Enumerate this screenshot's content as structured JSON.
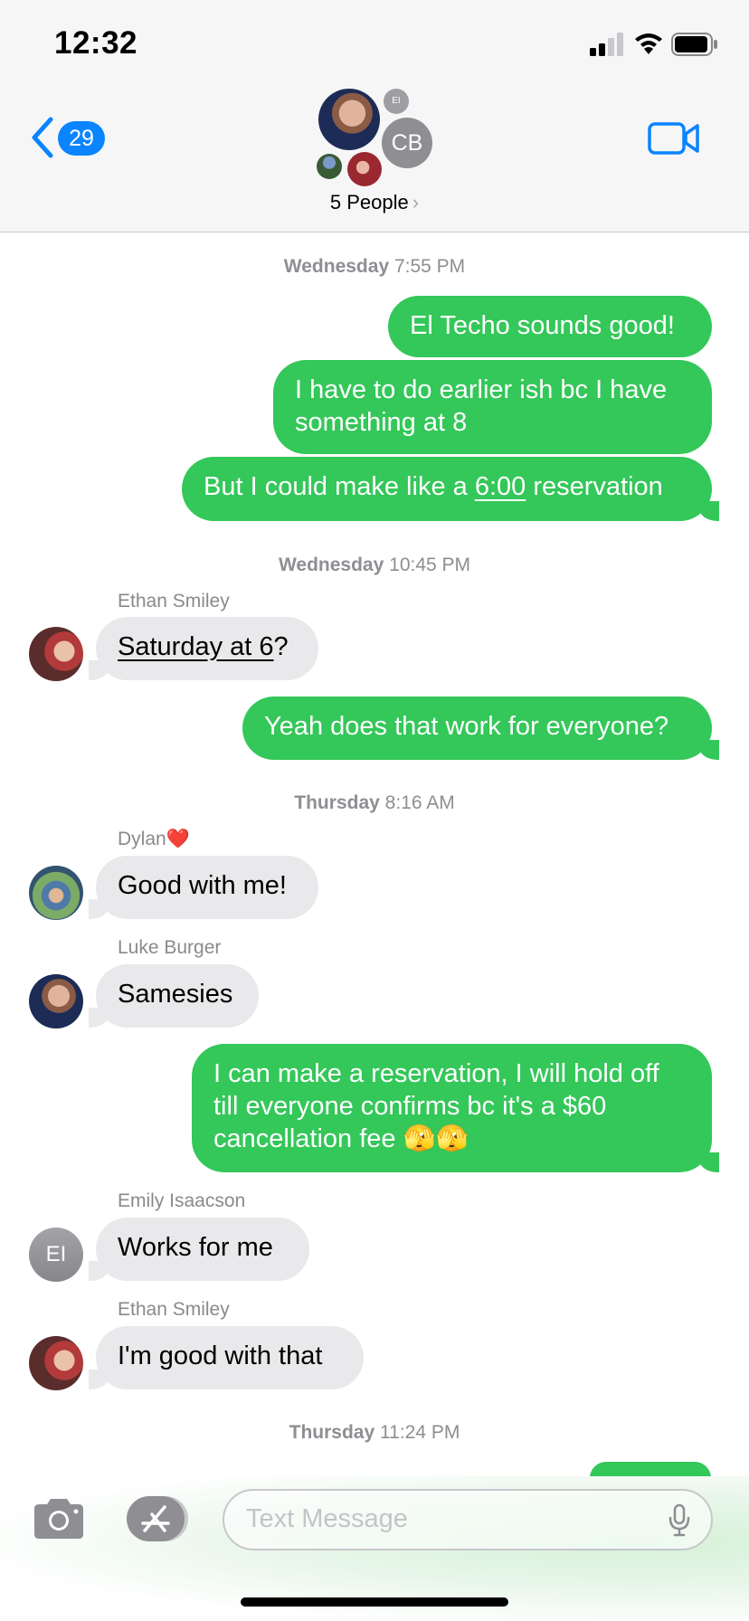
{
  "status_bar": {
    "time": "12:32"
  },
  "header": {
    "back_count": "29",
    "group_name": "5 People",
    "chevron": "›",
    "avatar_initials": {
      "cb": "CB",
      "ei": "EI"
    }
  },
  "messages": {
    "ts1": {
      "day": "Wednesday",
      "time": "7:55 PM"
    },
    "m1": "El Techo sounds good!",
    "m2_line1": "I have to do earlier ish bc I have",
    "m2_line2": "something at 8",
    "m3_pre": "But I could make like a ",
    "m3_link": "6:00",
    "m3_post": " reservation",
    "ts2": {
      "day": "Wednesday",
      "time": "10:45 PM"
    },
    "sender1": "Ethan Smiley",
    "m4_link": "Saturday at 6",
    "m4_post": "?",
    "m5": "Yeah does that work for everyone?",
    "ts3": {
      "day": "Thursday",
      "time": "8:16 AM"
    },
    "sender2": "Dylan",
    "sender2_emoji": "❤️",
    "m6": "Good with me!",
    "sender3": "Luke Burger",
    "m7": "Samesies",
    "m8_line1": "I can make a reservation, I will hold off",
    "m8_line2": "till everyone confirms bc it's a $60",
    "m8_line3": "cancellation fee 🫣🫣",
    "sender4": "Emily Isaacson",
    "sender4_initials": "EI",
    "m9": "Works for me",
    "sender5": "Ethan Smiley",
    "m10": "I'm good with that",
    "ts4": {
      "day": "Thursday",
      "time": "11:24 PM"
    }
  },
  "composer": {
    "placeholder": "Text Message"
  },
  "colors": {
    "outgoing": "#34c759",
    "incoming": "#e9e9eb",
    "accent": "#0a84ff"
  }
}
